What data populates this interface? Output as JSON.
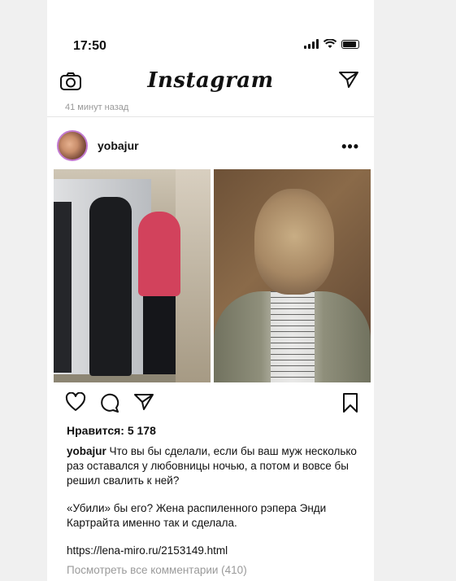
{
  "status_bar": {
    "time": "17:50"
  },
  "nav": {
    "logo": "Instagram"
  },
  "post": {
    "time_ago": "41 минут назад",
    "username": "yobajur",
    "more": "•••",
    "likes": "Нравится: 5 178",
    "caption_user": "yobajur",
    "caption_text": "Что вы бы сделали, если бы ваш муж несколько раз оставался у любовницы ночью, а потом и вовсе бы решил свалить к ней?",
    "caption_text2": "«Убили» бы его? Жена распиленного рэпера Энди Картрайта именно так и сделала.",
    "caption_link": "https://lena-miro.ru/2153149.html",
    "view_comments": "Посмотреть все комментарии (410)"
  },
  "icons": [
    "camera-icon",
    "direct-message-icon",
    "heart-icon",
    "comment-icon",
    "share-icon",
    "bookmark-icon",
    "more-icon"
  ]
}
